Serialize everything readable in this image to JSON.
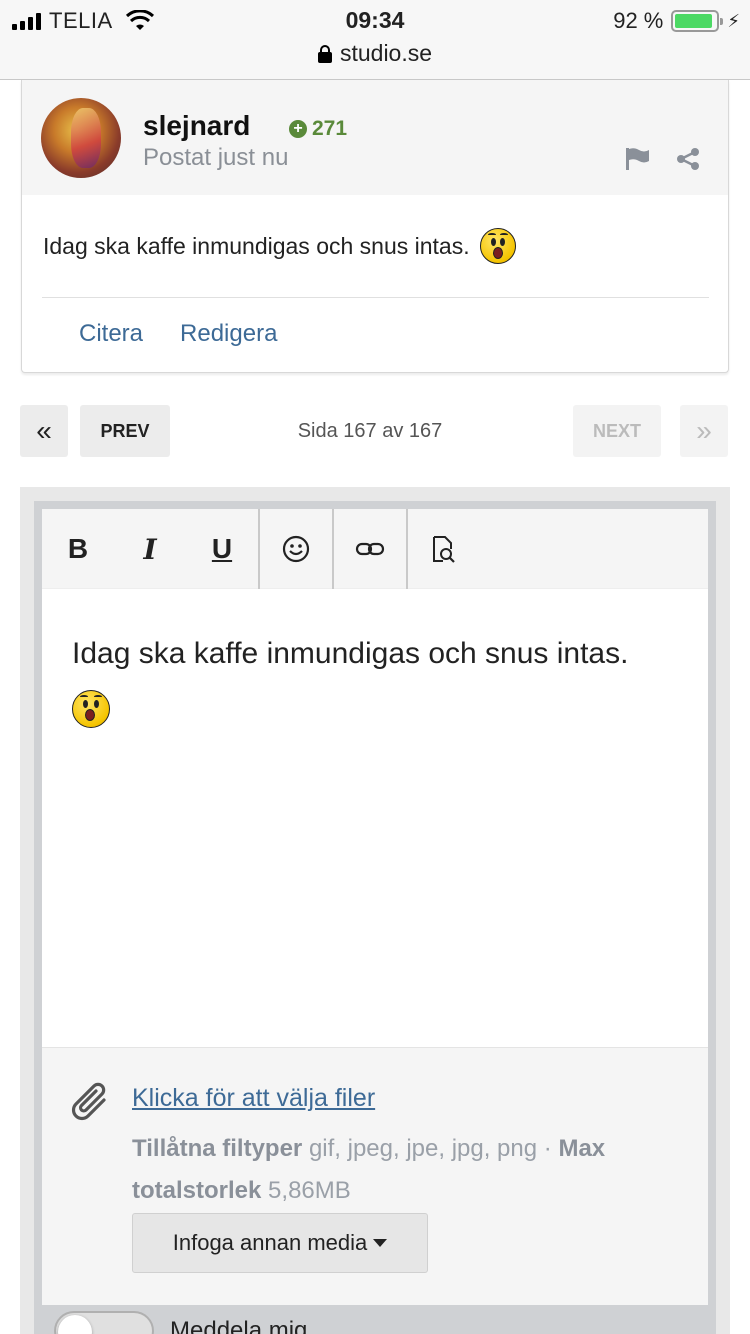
{
  "status": {
    "carrier": "TELIA",
    "time": "09:34",
    "battery": "92 %",
    "battery_level": 0.92,
    "url": "studio.se"
  },
  "post": {
    "username": "slejnard",
    "reputation": "271",
    "posted": "Postat just nu",
    "body": "Idag ska kaffe inmundigas och snus intas.",
    "actions": {
      "quote": "Citera",
      "edit": "Redigera"
    }
  },
  "pagination": {
    "first": "«",
    "prev": "PREV",
    "info": "Sida 167 av 167",
    "next": "NEXT",
    "last": "»"
  },
  "editor": {
    "toolbar": {
      "bold": "B",
      "italic": "I",
      "underline": "U"
    },
    "content": "Idag ska kaffe inmundigas och snus intas.",
    "attach": {
      "link": "Klicka för att välja filer",
      "types_label": "Tillåtna filtyper",
      "types": "gif, jpeg, jpe, jpg, png",
      "separator": "·",
      "max_label": "Max totalstorlek",
      "max_value": "5,86MB",
      "media_button": "Infoga annan media"
    },
    "toggle_label": "Meddela mig"
  },
  "colors": {
    "link": "#3d6a96",
    "reputation": "#5a8a3a",
    "battery": "#4cd964"
  }
}
